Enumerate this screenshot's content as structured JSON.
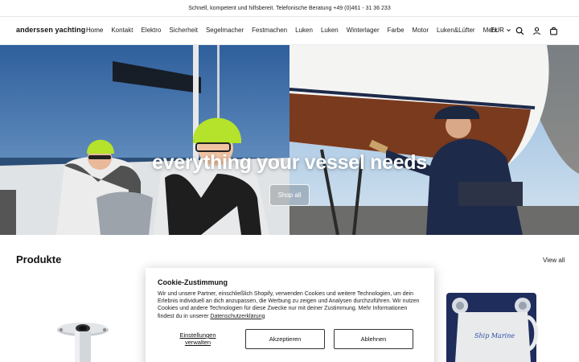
{
  "announcement": "Schnell, kompetent und hilfsbereit. Telefonische Beratung +49 (0)461 - 31 36 233",
  "header": {
    "logo": "anderssen yachting",
    "nav": [
      "Home",
      "Kontakt",
      "Elektro",
      "Sicherheit",
      "Segelmacher",
      "Festmachen",
      "Luken",
      "Luken",
      "Winterlager",
      "Farbe",
      "Motor",
      "Luken&Lüfter",
      "Mehr"
    ],
    "currency": "EUR",
    "icons": [
      "search-icon",
      "account-icon",
      "cart-icon"
    ]
  },
  "hero": {
    "title": "everything your vessel needs",
    "button": "Shop all"
  },
  "products": {
    "title": "Produkte",
    "view_all": "View all"
  },
  "cookie": {
    "title": "Cookie-Zustimmung",
    "text": "Wir und unsere Partner, einschließlich Shopify, verwenden Cookies und weitere Technologien, um dein Erlebnis individuell an dich anzupassen, die Werbung zu zeigen und Analysen durchzuführen. Wir nutzen Cookies und andere Technologien für diese Zwecke nur mit deiner Zustimmung. Mehr Informationen findest du in unserer",
    "link": "Datenschutzerklärung",
    "settings": "Einstellungen verwalten",
    "accept": "Akzeptieren",
    "decline": "Ablehnen"
  },
  "colors": {
    "accent_hat": "#b5e22a",
    "hull_red": "#7a3a1d",
    "navy": "#1e2a4a"
  }
}
